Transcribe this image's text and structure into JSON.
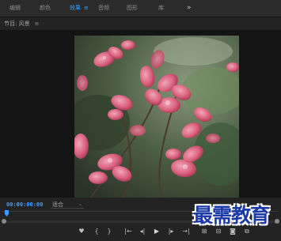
{
  "workspace_tabs": [
    {
      "label": "编辑",
      "active": false
    },
    {
      "label": "颜色",
      "active": false
    },
    {
      "label": "效果",
      "active": true,
      "menu": "≡"
    },
    {
      "label": "音频",
      "active": false
    },
    {
      "label": "图形",
      "active": false
    },
    {
      "label": "库",
      "active": false
    }
  ],
  "overflow_label": "»",
  "panel": {
    "title": "节目: 风景",
    "menu": "≡"
  },
  "viewer": {
    "image_subject": "pink azalea flowers",
    "colors": {
      "background": "#141414",
      "accent": "#3a9eff"
    }
  },
  "playback": {
    "timecode": "00:00:00:00",
    "fit_value": "适合",
    "fit_caret": "⌄",
    "playhead_position": 0.0
  },
  "transport_buttons": [
    {
      "name": "marker-icon",
      "glyph": "♥"
    },
    {
      "name": "mark-in-icon",
      "glyph": "{"
    },
    {
      "name": "mark-out-icon",
      "glyph": "}"
    },
    {
      "name": "go-to-in-icon",
      "glyph": "|←"
    },
    {
      "name": "step-back-icon",
      "glyph": "◂|"
    },
    {
      "name": "play-icon",
      "glyph": "▶"
    },
    {
      "name": "step-forward-icon",
      "glyph": "|▸"
    },
    {
      "name": "go-to-out-icon",
      "glyph": "→|"
    },
    {
      "name": "insert-icon",
      "glyph": "⊞"
    },
    {
      "name": "overwrite-icon",
      "glyph": "⊟"
    },
    {
      "name": "export-frame-icon",
      "glyph": "◙"
    },
    {
      "name": "button-editor-icon",
      "glyph": "⧉"
    }
  ],
  "watermark": {
    "text": "最需教育",
    "color": "#1b3aa8"
  }
}
